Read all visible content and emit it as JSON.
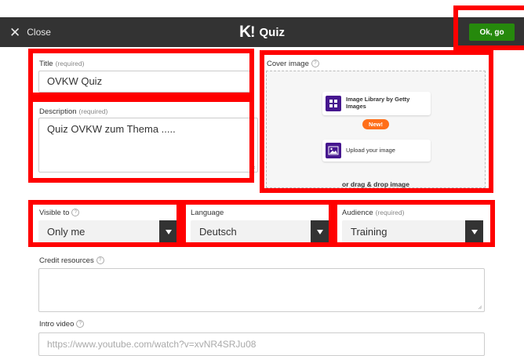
{
  "header": {
    "close_label": "Close",
    "logo_text": "K",
    "logo_bang": "!",
    "title": "Quiz",
    "ok_label": "Ok, go",
    "dark_bg": "#333333",
    "ok_color": "#26890c"
  },
  "form": {
    "title": {
      "label": "Title",
      "required": "(required)",
      "value": "OVKW Quiz"
    },
    "description": {
      "label": "Description",
      "required": "(required)",
      "value": "Quiz OVKW zum Thema ....."
    },
    "cover": {
      "label": "Cover image",
      "library_label": "Image Library by Getty Images",
      "new_badge": "New!",
      "upload_label": "Upload your image",
      "drag_text": "or drag & drop image"
    },
    "visible_to": {
      "label": "Visible to",
      "value": "Only me"
    },
    "language": {
      "label": "Language",
      "value": "Deutsch"
    },
    "audience": {
      "label": "Audience",
      "required": "(required)",
      "value": "Training"
    },
    "credit": {
      "label": "Credit resources",
      "value": ""
    },
    "intro_video": {
      "label": "Intro video",
      "placeholder": "https://www.youtube.com/watch?v=xvNR4SRJu08"
    }
  },
  "icons": {
    "close": "close-icon",
    "help": "help-icon",
    "library": "image-library-icon",
    "upload": "upload-image-icon",
    "dropdown": "chevron-down-icon"
  },
  "colors": {
    "highlight": "#ff0000",
    "purple": "#46178f",
    "badge": "#ff6f1a"
  }
}
